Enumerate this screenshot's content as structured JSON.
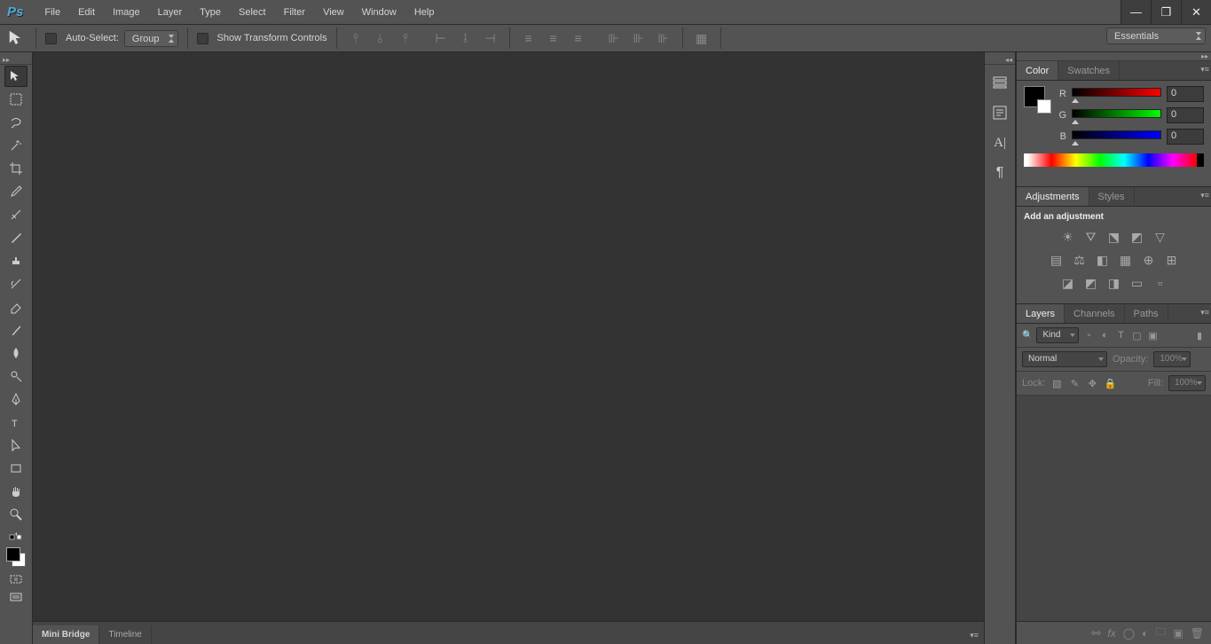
{
  "menu": {
    "items": [
      "File",
      "Edit",
      "Image",
      "Layer",
      "Type",
      "Select",
      "Filter",
      "View",
      "Window",
      "Help"
    ]
  },
  "optbar": {
    "auto_select": "Auto-Select:",
    "group": "Group",
    "show_transform": "Show Transform Controls"
  },
  "workspace": "Essentials",
  "panels": {
    "color": {
      "tabs": [
        "Color",
        "Swatches"
      ],
      "r": "R",
      "g": "G",
      "b": "B",
      "rv": "0",
      "gv": "0",
      "bv": "0"
    },
    "adjustments": {
      "tabs": [
        "Adjustments",
        "Styles"
      ],
      "title": "Add an adjustment"
    },
    "layers": {
      "tabs": [
        "Layers",
        "Channels",
        "Paths"
      ],
      "kind": "Kind",
      "blend": "Normal",
      "opacity_lbl": "Opacity:",
      "opacity": "100%",
      "lock": "Lock:",
      "fill_lbl": "Fill:",
      "fill": "100%"
    }
  },
  "bottom": {
    "tabs": [
      "Mini Bridge",
      "Timeline"
    ]
  }
}
